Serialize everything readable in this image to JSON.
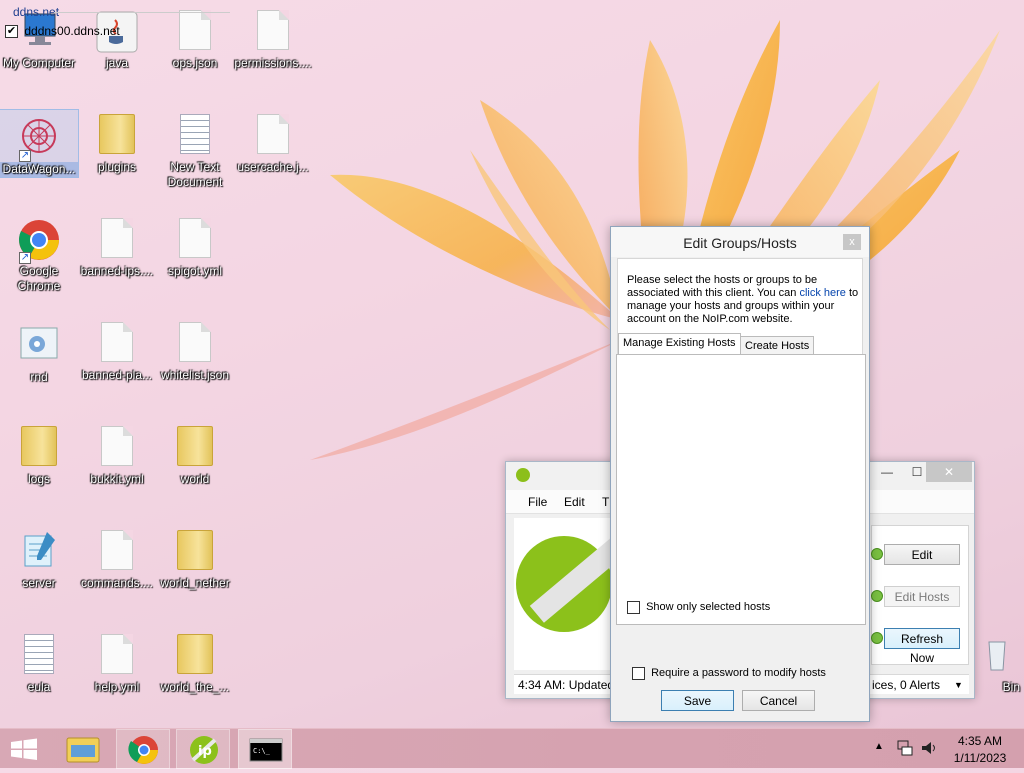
{
  "desktop": {
    "icons": [
      {
        "label": "My Computer"
      },
      {
        "label": "java"
      },
      {
        "label": "ops.json"
      },
      {
        "label": "permissions...."
      },
      {
        "label": "DataWagon..."
      },
      {
        "label": "plugins"
      },
      {
        "label": "New Text Document"
      },
      {
        "label": "usercache.j..."
      },
      {
        "label": "Google Chrome"
      },
      {
        "label": "banned-ips...."
      },
      {
        "label": "spigot.yml"
      },
      {
        "label": "rnd"
      },
      {
        "label": "banned-pla..."
      },
      {
        "label": "whitelist.json"
      },
      {
        "label": "logs"
      },
      {
        "label": "bukkit.yml"
      },
      {
        "label": "world"
      },
      {
        "label": "server"
      },
      {
        "label": "commands...."
      },
      {
        "label": "world_nether"
      },
      {
        "label": "eula"
      },
      {
        "label": "help.yml"
      },
      {
        "label": "world_the_..."
      },
      {
        "label": "Bin"
      }
    ]
  },
  "noip_window": {
    "menu": [
      "File",
      "Edit",
      "T"
    ],
    "buttons": {
      "edit": "Edit",
      "edit_hosts": "Edit Hosts",
      "refresh": "Refresh Now"
    },
    "status_left": "4:34 AM: Updated",
    "status_right": "ices, 0 Alerts"
  },
  "dialog": {
    "title": "Edit Groups/Hosts",
    "close": "x",
    "intro_before": "Please select the hosts or groups to be associated with this client. You can ",
    "intro_link": "click here",
    "intro_after": " to manage your hosts and groups within your account on the NoIP.com website.",
    "tabs": [
      "Manage Existing Hosts",
      "Create Hosts"
    ],
    "group": "ddns.net",
    "host": {
      "label": "dddns00.ddns.net",
      "checked": true
    },
    "show_only_selected": "Show only selected hosts",
    "require_password": "Require a password to modify hosts",
    "save": "Save",
    "cancel": "Cancel"
  },
  "taskbar": {
    "time": "4:35 AM",
    "date": "1/11/2023"
  },
  "colors": {
    "noip_green": "#8cc11b",
    "link": "#0645ad",
    "taskbar": "#d6a2b0"
  }
}
